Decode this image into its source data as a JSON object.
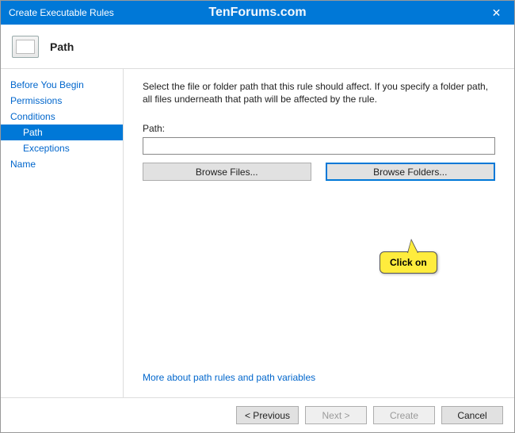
{
  "window": {
    "title": "Create Executable Rules",
    "watermark": "TenForums.com"
  },
  "header": {
    "title": "Path"
  },
  "sidebar": {
    "items": [
      {
        "label": "Before You Begin",
        "type": "item"
      },
      {
        "label": "Permissions",
        "type": "item"
      },
      {
        "label": "Conditions",
        "type": "item"
      },
      {
        "label": "Path",
        "type": "sub",
        "selected": true
      },
      {
        "label": "Exceptions",
        "type": "sub"
      },
      {
        "label": "Name",
        "type": "item"
      }
    ]
  },
  "content": {
    "description": "Select the file or folder path that this rule should affect. If you specify a folder path, all files underneath that path will be affected by the rule.",
    "path_label": "Path:",
    "path_value": "",
    "browse_files": "Browse Files...",
    "browse_folders": "Browse Folders...",
    "more_link": "More about path rules and path variables"
  },
  "callout": {
    "text": "Click on"
  },
  "footer": {
    "previous": "< Previous",
    "next": "Next >",
    "create": "Create",
    "cancel": "Cancel"
  }
}
